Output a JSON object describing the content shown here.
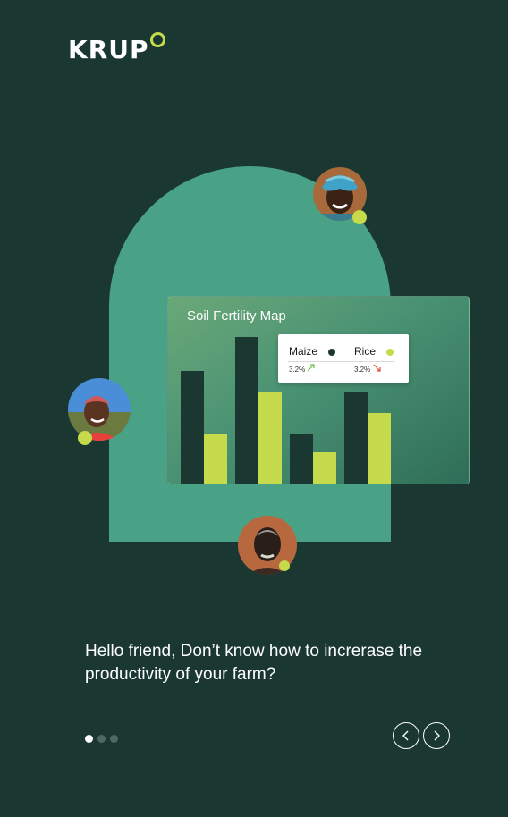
{
  "brand": {
    "logo_text": "KRUP",
    "accent": "#c6db4c"
  },
  "chart_data": {
    "type": "bar",
    "title": "Soil Fertility Map",
    "categories": [
      "",
      "",
      "",
      ""
    ],
    "series": [
      {
        "name": "Maize",
        "color": "#1a3831",
        "values": [
          128,
          166,
          58,
          105
        ]
      },
      {
        "name": "Rice",
        "color": "#c6db4c",
        "values": [
          57,
          105,
          37,
          81
        ]
      }
    ],
    "ylim": [
      0,
      170
    ],
    "grid": false,
    "legend": "top-right",
    "legend_entries": [
      {
        "name": "Maize",
        "change": "3.2%",
        "trend": "up",
        "trend_icon": "trend-up-arrow-icon"
      },
      {
        "name": "Rice",
        "change": "3.2%",
        "trend": "down",
        "trend_icon": "trend-down-arrow-icon"
      }
    ]
  },
  "avatars": [
    {
      "name": "farmer-avatar-top",
      "status": "online"
    },
    {
      "name": "farmer-avatar-left",
      "status": "online"
    },
    {
      "name": "farmer-avatar-bottom",
      "status": "online"
    }
  ],
  "onboarding": {
    "headline": "Hello friend, Don’t know how to increrase the productivity of your farm?",
    "page_count": 3,
    "current_page": 1
  },
  "navigation": {
    "prev_icon": "chevron-left-icon",
    "next_icon": "chevron-right-icon"
  }
}
